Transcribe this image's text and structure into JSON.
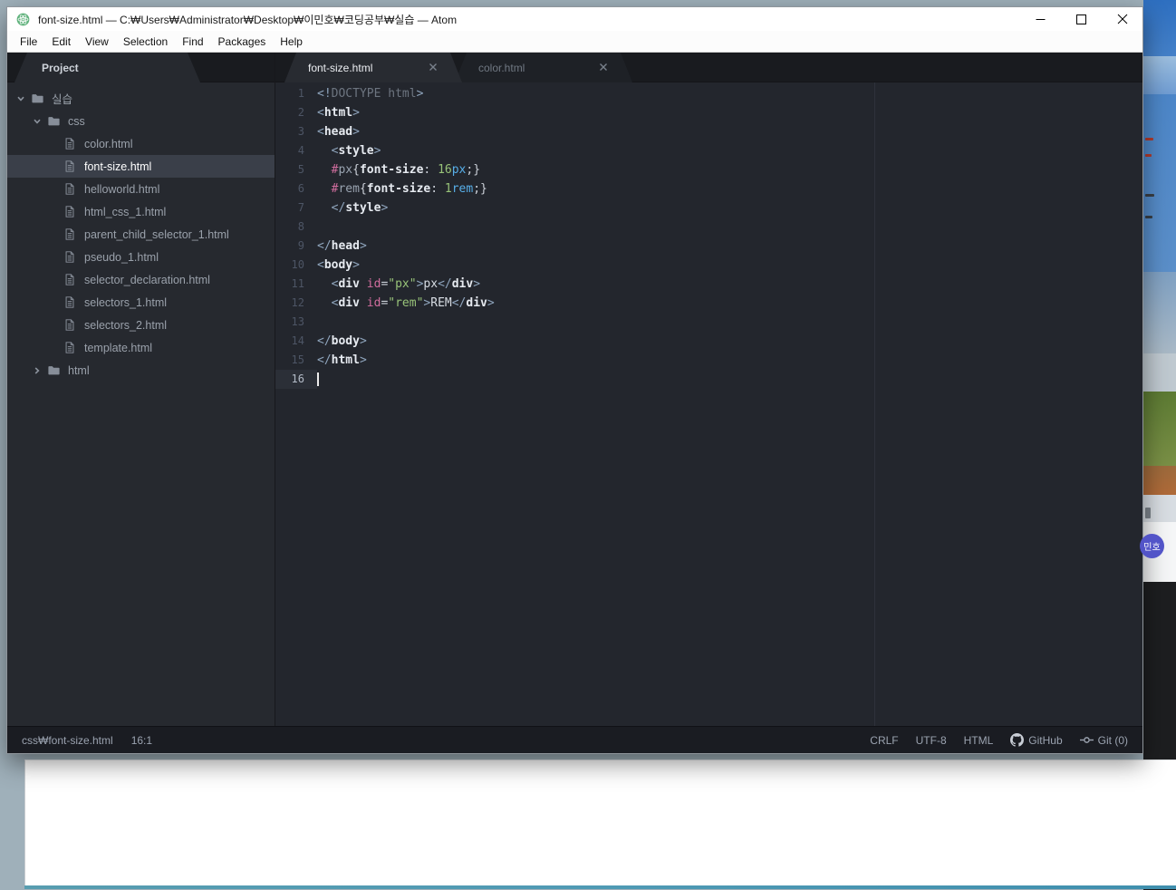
{
  "window": {
    "title": "font-size.html — C:₩Users₩Administrator₩Desktop₩이민호₩코딩공부₩실습 — Atom",
    "app_icon": "atom-logo",
    "controls": [
      "minimize",
      "maximize",
      "close"
    ]
  },
  "menu": {
    "items": [
      "File",
      "Edit",
      "View",
      "Selection",
      "Find",
      "Packages",
      "Help"
    ]
  },
  "project_panel": {
    "tab_label": "Project",
    "tree": [
      {
        "label": "실습",
        "type": "folder",
        "depth": 0,
        "expanded": true
      },
      {
        "label": "css",
        "type": "folder",
        "depth": 1,
        "expanded": true
      },
      {
        "label": "color.html",
        "type": "file",
        "depth": 2
      },
      {
        "label": "font-size.html",
        "type": "file",
        "depth": 2,
        "selected": true
      },
      {
        "label": "helloworld.html",
        "type": "file",
        "depth": 2
      },
      {
        "label": "html_css_1.html",
        "type": "file",
        "depth": 2
      },
      {
        "label": "parent_child_selector_1.html",
        "type": "file",
        "depth": 2
      },
      {
        "label": "pseudo_1.html",
        "type": "file",
        "depth": 2
      },
      {
        "label": "selector_declaration.html",
        "type": "file",
        "depth": 2
      },
      {
        "label": "selectors_1.html",
        "type": "file",
        "depth": 2
      },
      {
        "label": "selectors_2.html",
        "type": "file",
        "depth": 2
      },
      {
        "label": "template.html",
        "type": "file",
        "depth": 2
      },
      {
        "label": "html",
        "type": "folder",
        "depth": 1,
        "expanded": false
      }
    ]
  },
  "tabs": [
    {
      "label": "font-size.html",
      "active": true
    },
    {
      "label": "color.html",
      "active": false
    }
  ],
  "editor": {
    "active_line": 16,
    "cursor": {
      "line": 16,
      "column": 1
    },
    "lines": [
      {
        "num": 1,
        "tokens": [
          [
            "br",
            "<!"
          ],
          [
            "gy",
            "DOCTYPE html"
          ],
          [
            "br",
            ">"
          ]
        ]
      },
      {
        "num": 2,
        "tokens": [
          [
            "br",
            "<"
          ],
          [
            "tag",
            "html"
          ],
          [
            "br",
            ">"
          ]
        ]
      },
      {
        "num": 3,
        "tokens": [
          [
            "br",
            "<"
          ],
          [
            "tag",
            "head"
          ],
          [
            "br",
            ">"
          ]
        ]
      },
      {
        "num": 4,
        "tokens": [
          [
            "pl",
            "  "
          ],
          [
            "br",
            "<"
          ],
          [
            "tag",
            "style"
          ],
          [
            "br",
            ">"
          ]
        ]
      },
      {
        "num": 5,
        "tokens": [
          [
            "pl",
            "  "
          ],
          [
            "pk",
            "#"
          ],
          [
            "sl",
            "px"
          ],
          [
            "pb",
            "{"
          ],
          [
            "pr",
            "font-size"
          ],
          [
            "pb",
            ": "
          ],
          [
            "nm",
            "16"
          ],
          [
            "un",
            "px"
          ],
          [
            "pb",
            ";}"
          ]
        ]
      },
      {
        "num": 6,
        "tokens": [
          [
            "pl",
            "  "
          ],
          [
            "pk",
            "#"
          ],
          [
            "sl",
            "rem"
          ],
          [
            "pb",
            "{"
          ],
          [
            "pr",
            "font-size"
          ],
          [
            "pb",
            ": "
          ],
          [
            "nm",
            "1"
          ],
          [
            "un",
            "rem"
          ],
          [
            "pb",
            ";}"
          ]
        ]
      },
      {
        "num": 7,
        "tokens": [
          [
            "pl",
            "  "
          ],
          [
            "br",
            "</"
          ],
          [
            "tag",
            "style"
          ],
          [
            "br",
            ">"
          ]
        ]
      },
      {
        "num": 8,
        "tokens": []
      },
      {
        "num": 9,
        "tokens": [
          [
            "br",
            "</"
          ],
          [
            "tag",
            "head"
          ],
          [
            "br",
            ">"
          ]
        ]
      },
      {
        "num": 10,
        "tokens": [
          [
            "br",
            "<"
          ],
          [
            "tag",
            "body"
          ],
          [
            "br",
            ">"
          ]
        ]
      },
      {
        "num": 11,
        "tokens": [
          [
            "pl",
            "  "
          ],
          [
            "br",
            "<"
          ],
          [
            "tag",
            "div"
          ],
          [
            "pl",
            " "
          ],
          [
            "pk",
            "id"
          ],
          [
            "pb",
            "="
          ],
          [
            "st",
            "\"px\""
          ],
          [
            "br",
            ">"
          ],
          [
            "tx",
            "px"
          ],
          [
            "br",
            "</"
          ],
          [
            "tag",
            "div"
          ],
          [
            "br",
            ">"
          ]
        ]
      },
      {
        "num": 12,
        "tokens": [
          [
            "pl",
            "  "
          ],
          [
            "br",
            "<"
          ],
          [
            "tag",
            "div"
          ],
          [
            "pl",
            " "
          ],
          [
            "pk",
            "id"
          ],
          [
            "pb",
            "="
          ],
          [
            "st",
            "\"rem\""
          ],
          [
            "br",
            ">"
          ],
          [
            "tx",
            "REM"
          ],
          [
            "br",
            "</"
          ],
          [
            "tag",
            "div"
          ],
          [
            "br",
            ">"
          ]
        ]
      },
      {
        "num": 13,
        "tokens": []
      },
      {
        "num": 14,
        "tokens": [
          [
            "br",
            "</"
          ],
          [
            "tag",
            "body"
          ],
          [
            "br",
            ">"
          ]
        ]
      },
      {
        "num": 15,
        "tokens": [
          [
            "br",
            "</"
          ],
          [
            "tag",
            "html"
          ],
          [
            "br",
            ">"
          ]
        ]
      },
      {
        "num": 16,
        "tokens": []
      }
    ]
  },
  "status_bar": {
    "left": [
      "css₩font-size.html",
      "16:1"
    ],
    "right": [
      {
        "label": "CRLF"
      },
      {
        "label": "UTF-8"
      },
      {
        "label": "HTML"
      },
      {
        "label": "GitHub",
        "icon": "github-logo"
      },
      {
        "label": "Git (0)",
        "icon": "git-commit"
      }
    ]
  },
  "overlay": {
    "badge_label": "민호"
  },
  "colors": {
    "titlebar_bg": "#ffffff",
    "editor_bg": "#23262d",
    "tree_bg": "#26292f",
    "selected_row_bg": "#3a3f49",
    "tabbar_bg": "#191b1f",
    "statusbar_bg": "#1a1c22",
    "atom_logo_green": "#62b37e",
    "badge_indigo": "#5254c8",
    "syntax_tag": "#e6eaf0",
    "syntax_bracket": "#8fa5bd",
    "syntax_pink": "#d16d9e",
    "syntax_string": "#98c379",
    "syntax_number": "#98c379",
    "syntax_unit": "#57aee8",
    "syntax_comment": "#6d7580"
  }
}
